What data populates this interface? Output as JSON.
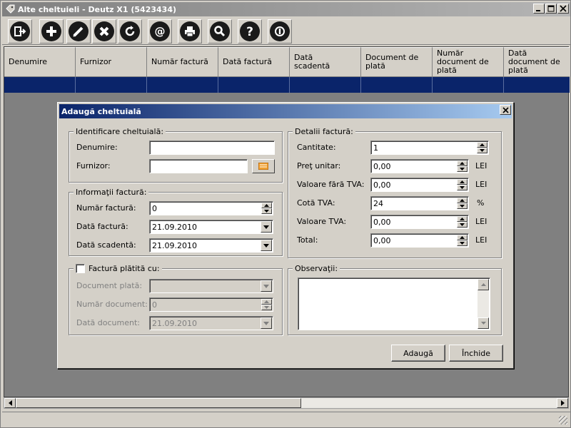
{
  "window": {
    "title": "Alte cheltuieli - Deutz X1 (5423434)"
  },
  "toolbar": {
    "items": [
      {
        "name": "exit-icon"
      },
      {
        "name": "add-icon"
      },
      {
        "name": "edit-icon"
      },
      {
        "name": "delete-icon"
      },
      {
        "name": "refresh-icon"
      },
      {
        "name": "email-icon"
      },
      {
        "name": "print-icon"
      },
      {
        "name": "search-icon"
      },
      {
        "name": "help-icon"
      },
      {
        "name": "info-icon"
      }
    ]
  },
  "grid": {
    "columns": [
      "Denumire",
      "Furnizor",
      "Număr factură",
      "Dată factură",
      "Dată scadentă",
      "Document de plată",
      "Număr document de plată",
      "Dată document de plată"
    ]
  },
  "dialog": {
    "title": "Adaugă cheltuială",
    "identificare": {
      "title": "Identificare cheltuială:",
      "denumire_label": "Denumire:",
      "denumire_value": "",
      "furnizor_label": "Furnizor:",
      "furnizor_value": ""
    },
    "informatii": {
      "title": "Informaţii factură:",
      "numar_label": "Număr factură:",
      "numar_value": "0",
      "data_label": "Dată factură:",
      "data_value": "21.09.2010",
      "scadenta_label": "Dată scadentă:",
      "scadenta_value": "21.09.2010"
    },
    "platita": {
      "title": "Factură plătită cu:",
      "checked": false,
      "document_label": "Document plată:",
      "document_value": "",
      "numar_label": "Număr document:",
      "numar_value": "0",
      "data_label": "Dată document:",
      "data_value": "21.09.2010"
    },
    "detalii": {
      "title": "Detalii factură:",
      "cantitate_label": "Cantitate:",
      "cantitate_value": "1",
      "pret_label": "Preţ unitar:",
      "pret_value": "0,00",
      "pret_unit": "LEI",
      "fara_tva_label": "Valoare fără TVA:",
      "fara_tva_value": "0,00",
      "fara_tva_unit": "LEI",
      "cota_label": "Cotă TVA:",
      "cota_value": "24",
      "cota_unit": "%",
      "valoare_tva_label": "Valoare TVA:",
      "valoare_tva_value": "0,00",
      "valoare_tva_unit": "LEI",
      "total_label": "Total:",
      "total_value": "0,00",
      "total_unit": "LEI"
    },
    "observatii": {
      "title": "Observaţii:",
      "value": ""
    },
    "buttons": {
      "add": "Adaugă",
      "close": "Închide"
    }
  }
}
